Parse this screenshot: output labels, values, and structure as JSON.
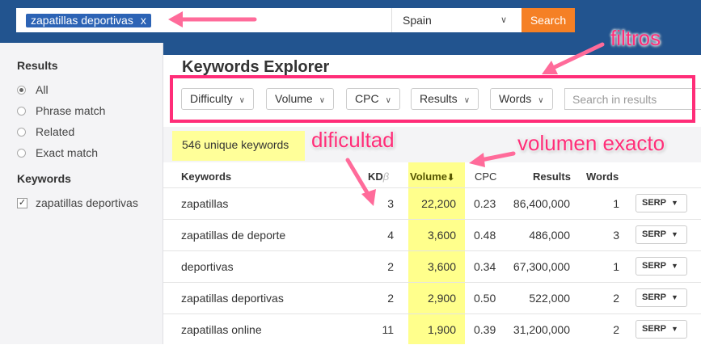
{
  "header": {
    "search_chip": "zapatillas deportivas",
    "chip_remove": "x",
    "country": "Spain",
    "search_button": "Search"
  },
  "sidebar": {
    "results_heading": "Results",
    "options": [
      {
        "label": "All",
        "selected": true
      },
      {
        "label": "Phrase match",
        "selected": false
      },
      {
        "label": "Related",
        "selected": false
      },
      {
        "label": "Exact match",
        "selected": false
      }
    ],
    "keywords_heading": "Keywords",
    "keywords": [
      {
        "label": "zapatillas deportivas",
        "checked": true
      }
    ]
  },
  "main": {
    "title": "Keywords Explorer",
    "filters": [
      "Difficulty",
      "Volume",
      "CPC",
      "Results",
      "Words"
    ],
    "search_placeholder": "Search in results",
    "count": "546 unique keywords",
    "columns": {
      "keyword": "Keywords",
      "kd": "KD",
      "kd_beta": "β",
      "volume": "Volume",
      "volume_sort": "⬇",
      "cpc": "CPC",
      "results": "Results",
      "words": "Words"
    },
    "serp_label": "SERP",
    "rows": [
      {
        "keyword": "zapatillas",
        "kd": "3",
        "volume": "22,200",
        "cpc": "0.23",
        "results": "86,400,000",
        "words": "1"
      },
      {
        "keyword": "zapatillas de deporte",
        "kd": "4",
        "volume": "3,600",
        "cpc": "0.48",
        "results": "486,000",
        "words": "3"
      },
      {
        "keyword": "deportivas",
        "kd": "2",
        "volume": "3,600",
        "cpc": "0.34",
        "results": "67,300,000",
        "words": "1"
      },
      {
        "keyword": "zapatillas deportivas",
        "kd": "2",
        "volume": "2,900",
        "cpc": "0.50",
        "results": "522,000",
        "words": "2"
      },
      {
        "keyword": "zapatillas online",
        "kd": "11",
        "volume": "1,900",
        "cpc": "0.39",
        "results": "31,200,000",
        "words": "2"
      }
    ]
  },
  "annotations": {
    "filters": "filtros",
    "difficulty": "dificultad",
    "volume": "volumen exacto",
    "color": "#ff2d78"
  },
  "colors": {
    "header": "#22548f",
    "search_button": "#f58025",
    "highlight": "#ffff8c",
    "chip": "#2c63b5"
  }
}
